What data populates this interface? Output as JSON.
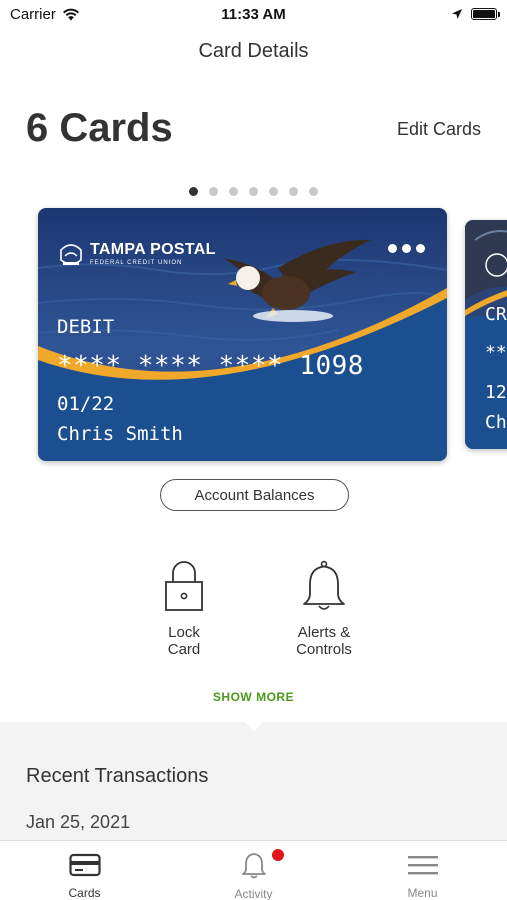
{
  "status_bar": {
    "carrier": "Carrier",
    "time": "11:33 AM"
  },
  "nav": {
    "title": "Card Details"
  },
  "header": {
    "count_label": "6 Cards",
    "edit_label": "Edit Cards"
  },
  "pager": {
    "total": 7,
    "active_index": 0
  },
  "card": {
    "issuer_name": "TAMPA POSTAL",
    "issuer_sub": "FEDERAL CREDIT UNION",
    "type": "DEBIT",
    "number": "**** **** **** 1098",
    "expiry": "01/22",
    "holder": "Chris Smith",
    "colors": {
      "navy": "#1c4f8f",
      "gold": "#f0a82a",
      "water": "#2a4c86"
    }
  },
  "next_card_peek": {
    "type": "CR",
    "number": "**",
    "expiry": "12",
    "holder": "Ch"
  },
  "balances_button": {
    "label": "Account Balances"
  },
  "actions": [
    {
      "label": "Lock\nCard",
      "icon": "lock-icon"
    },
    {
      "label": "Alerts &\nControls",
      "icon": "bell-icon"
    }
  ],
  "show_more": {
    "label": "SHOW MORE",
    "color": "#4a9a1e"
  },
  "recent": {
    "title": "Recent Transactions",
    "date": "Jan 25, 2021"
  },
  "tabs": [
    {
      "label": "Cards",
      "icon": "card-icon",
      "active": true
    },
    {
      "label": "Activity",
      "icon": "bell-icon",
      "badge": true
    },
    {
      "label": "Menu",
      "icon": "hamburger-icon"
    }
  ],
  "badge_color": "#e0161b"
}
